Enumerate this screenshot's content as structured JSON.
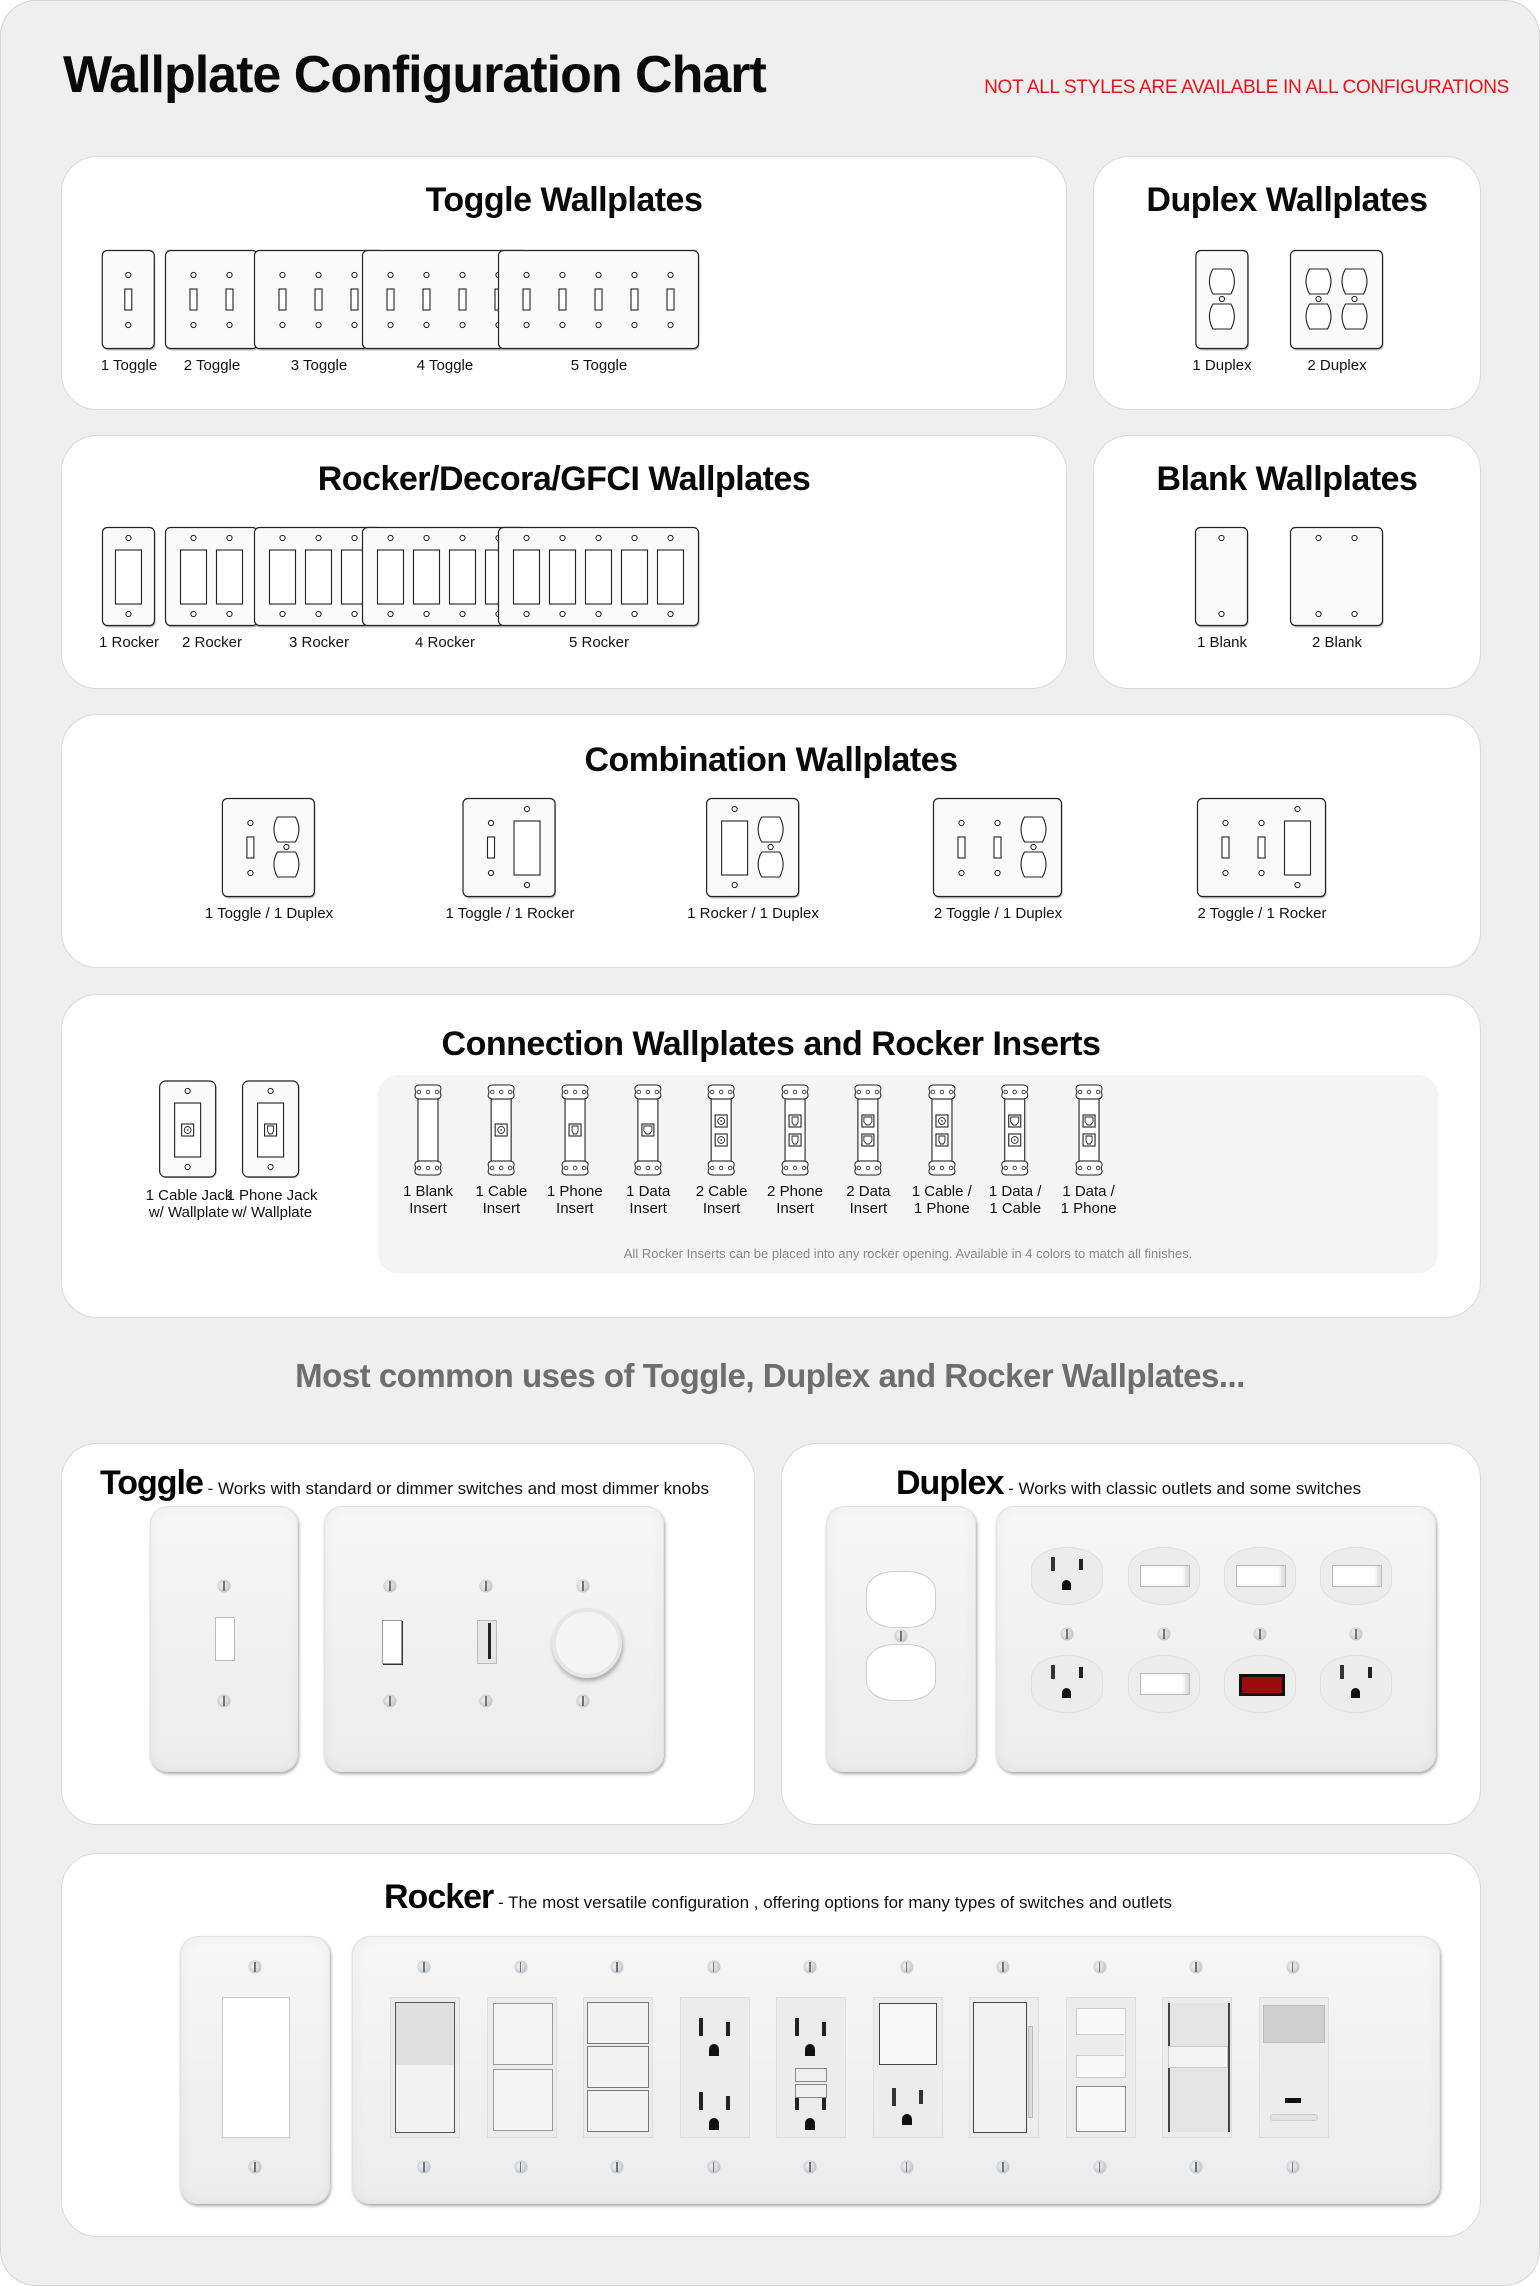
{
  "header": {
    "title": "Wallplate Configuration Chart",
    "warning": "NOT ALL STYLES ARE AVAILABLE IN ALL CONFIGURATIONS",
    "warning_color": "#e8141b"
  },
  "sections": {
    "toggle": {
      "title": "Toggle Wallplates",
      "items": [
        {
          "label": "1 Toggle",
          "gang": [
            "toggle"
          ]
        },
        {
          "label": "2 Toggle",
          "gang": [
            "toggle",
            "toggle"
          ]
        },
        {
          "label": "3 Toggle",
          "gang": [
            "toggle",
            "toggle",
            "toggle"
          ]
        },
        {
          "label": "4 Toggle",
          "gang": [
            "toggle",
            "toggle",
            "toggle",
            "toggle"
          ]
        },
        {
          "label": "5 Toggle",
          "gang": [
            "toggle",
            "toggle",
            "toggle",
            "toggle",
            "toggle"
          ]
        }
      ]
    },
    "duplex": {
      "title": "Duplex Wallplates",
      "items": [
        {
          "label": "1 Duplex",
          "gang": [
            "duplex"
          ]
        },
        {
          "label": "2 Duplex",
          "gang": [
            "duplex",
            "duplex"
          ]
        }
      ]
    },
    "rocker": {
      "title": "Rocker/Decora/GFCI Wallplates",
      "items": [
        {
          "label": "1 Rocker",
          "gang": [
            "rocker"
          ]
        },
        {
          "label": "2 Rocker",
          "gang": [
            "rocker",
            "rocker"
          ]
        },
        {
          "label": "3 Rocker",
          "gang": [
            "rocker",
            "rocker",
            "rocker"
          ]
        },
        {
          "label": "4 Rocker",
          "gang": [
            "rocker",
            "rocker",
            "rocker",
            "rocker"
          ]
        },
        {
          "label": "5 Rocker",
          "gang": [
            "rocker",
            "rocker",
            "rocker",
            "rocker",
            "rocker"
          ]
        }
      ]
    },
    "blank": {
      "title": "Blank Wallplates",
      "items": [
        {
          "label": "1 Blank",
          "gang": [
            "blank"
          ]
        },
        {
          "label": "2 Blank",
          "gang": [
            "blank",
            "blank"
          ]
        }
      ]
    },
    "combination": {
      "title": "Combination Wallplates",
      "items": [
        {
          "label": "1 Toggle / 1 Duplex",
          "gang": [
            "toggle",
            "duplex"
          ]
        },
        {
          "label": "1 Toggle / 1 Rocker",
          "gang": [
            "toggle",
            "rocker"
          ]
        },
        {
          "label": "1 Rocker / 1 Duplex",
          "gang": [
            "rocker",
            "duplex"
          ]
        },
        {
          "label": "2 Toggle / 1 Duplex",
          "gang": [
            "toggle",
            "toggle",
            "duplex"
          ]
        },
        {
          "label": "2 Toggle / 1 Rocker",
          "gang": [
            "toggle",
            "toggle",
            "rocker"
          ]
        }
      ]
    },
    "connection": {
      "title": "Connection Wallplates and Rocker Inserts",
      "wallplates": [
        {
          "label_line1": "1 Cable Jack",
          "label_line2": "w/ Wallplate",
          "ports": [
            "cable"
          ]
        },
        {
          "label_line1": "1 Phone Jack",
          "label_line2": "w/ Wallplate",
          "ports": [
            "phone"
          ]
        }
      ],
      "inserts": [
        {
          "label_line1": "1 Blank",
          "label_line2": "Insert",
          "ports": []
        },
        {
          "label_line1": "1 Cable",
          "label_line2": "Insert",
          "ports": [
            "cable"
          ]
        },
        {
          "label_line1": "1 Phone",
          "label_line2": "Insert",
          "ports": [
            "phone"
          ]
        },
        {
          "label_line1": "1 Data",
          "label_line2": "Insert",
          "ports": [
            "data"
          ]
        },
        {
          "label_line1": "2 Cable",
          "label_line2": "Insert",
          "ports": [
            "cable",
            "cable"
          ]
        },
        {
          "label_line1": "2 Phone",
          "label_line2": "Insert",
          "ports": [
            "phone",
            "phone"
          ]
        },
        {
          "label_line1": "2 Data",
          "label_line2": "Insert",
          "ports": [
            "data",
            "data"
          ]
        },
        {
          "label_line1": "1 Cable /",
          "label_line2": "1 Phone",
          "ports": [
            "cable",
            "phone"
          ]
        },
        {
          "label_line1": "1 Data /",
          "label_line2": "1 Cable",
          "ports": [
            "data",
            "cable"
          ]
        },
        {
          "label_line1": "1 Data /",
          "label_line2": "1 Phone",
          "ports": [
            "data",
            "phone"
          ]
        }
      ],
      "note": "All Rocker Inserts can be placed into any rocker opening. Available in 4 colors to match all finishes."
    }
  },
  "common_uses": {
    "heading": "Most common uses of Toggle, Duplex and Rocker Wallplates...",
    "toggle": {
      "title": "Toggle",
      "description": " - Works with standard or dimmer switches and most dimmer knobs",
      "single_plate": "toggle-opening",
      "multi_plate_devices": [
        "toggle-switch",
        "slide-dimmer",
        "rotary-dimmer-knob"
      ]
    },
    "duplex": {
      "title": "Duplex",
      "description": " - Works with classic outlets and some switches",
      "single_plate": "duplex-opening",
      "multi_plate_devices": [
        {
          "top": "outlet",
          "bottom": "outlet"
        },
        {
          "top": "toggle-switch",
          "bottom": "toggle-switch"
        },
        {
          "top": "toggle-switch",
          "bottom": "pilot-light"
        },
        {
          "top": "toggle-switch",
          "bottom": "outlet"
        }
      ],
      "pilot_light_color": "#9b0d0d"
    },
    "rocker": {
      "title": "Rocker",
      "description": " - The most versatile configuration , offering options for many types of switches and outlets",
      "single_plate": "rocker-opening",
      "multi_plate_devices": [
        "rocker-switch",
        "double-rocker",
        "triple-rocker",
        "gfci-style-outlet",
        "gfci-outlet",
        "switch-outlet-combo",
        "rocker-dimmer",
        "slide-dimmer-switch",
        "slide-dimmer",
        "occupancy-sensor"
      ]
    }
  }
}
